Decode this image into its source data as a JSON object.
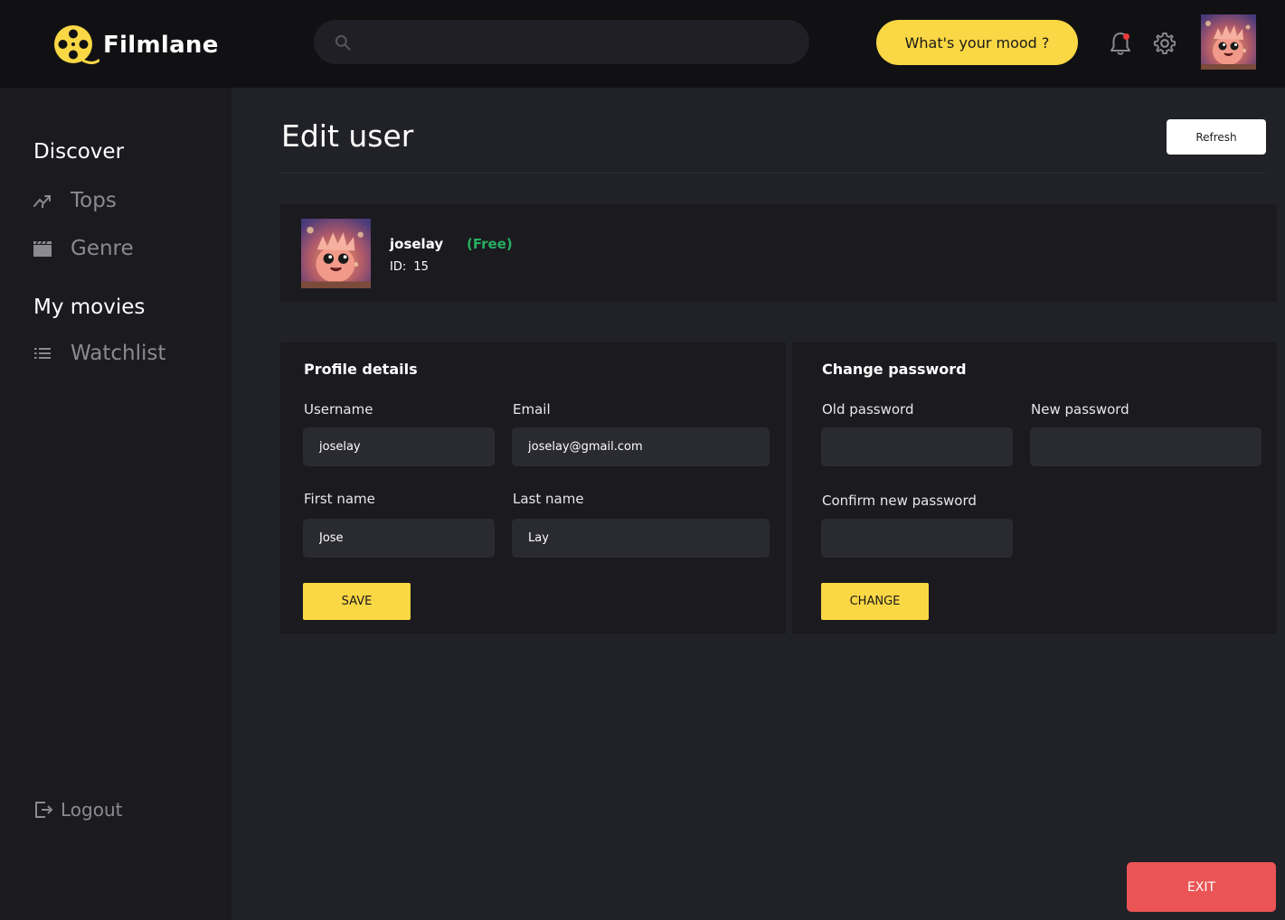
{
  "app": {
    "brand": "Filmlane",
    "accent_color": "#fad744"
  },
  "header": {
    "search_placeholder": "",
    "mood_button": "What's your mood ?",
    "icons": [
      "search-icon",
      "bell-icon",
      "gear-icon"
    ],
    "notification_dot_color": "#ea3a3a"
  },
  "sidebar": {
    "discover_heading": "Discover",
    "discover_items": [
      {
        "label": "Tops",
        "icon": "trending-icon"
      },
      {
        "label": "Genre",
        "icon": "clapperboard-icon"
      }
    ],
    "mymovies_heading": "My movies",
    "mymovies_items": [
      {
        "label": "Watchlist",
        "icon": "list-icon"
      }
    ],
    "logout_label": "Logout"
  },
  "page": {
    "title": "Edit user",
    "refresh_label": "Refresh"
  },
  "user": {
    "username": "joselay",
    "plan": "(Free)",
    "plan_color": "#27ae60",
    "id_label": "ID:",
    "id_value": "15"
  },
  "profile": {
    "title": "Profile details",
    "username_label": "Username",
    "username_value": "joselay",
    "email_label": "Email",
    "email_value": "joselay@gmail.com",
    "firstname_label": "First name",
    "firstname_value": "Jose",
    "lastname_label": "Last name",
    "lastname_value": "Lay",
    "save_label": "SAVE"
  },
  "password": {
    "title": "Change password",
    "old_label": "Old password",
    "new_label": "New password",
    "confirm_label": "Confirm new password",
    "change_label": "CHANGE"
  },
  "exit_label": "EXIT",
  "exit_color": "#ea5455"
}
